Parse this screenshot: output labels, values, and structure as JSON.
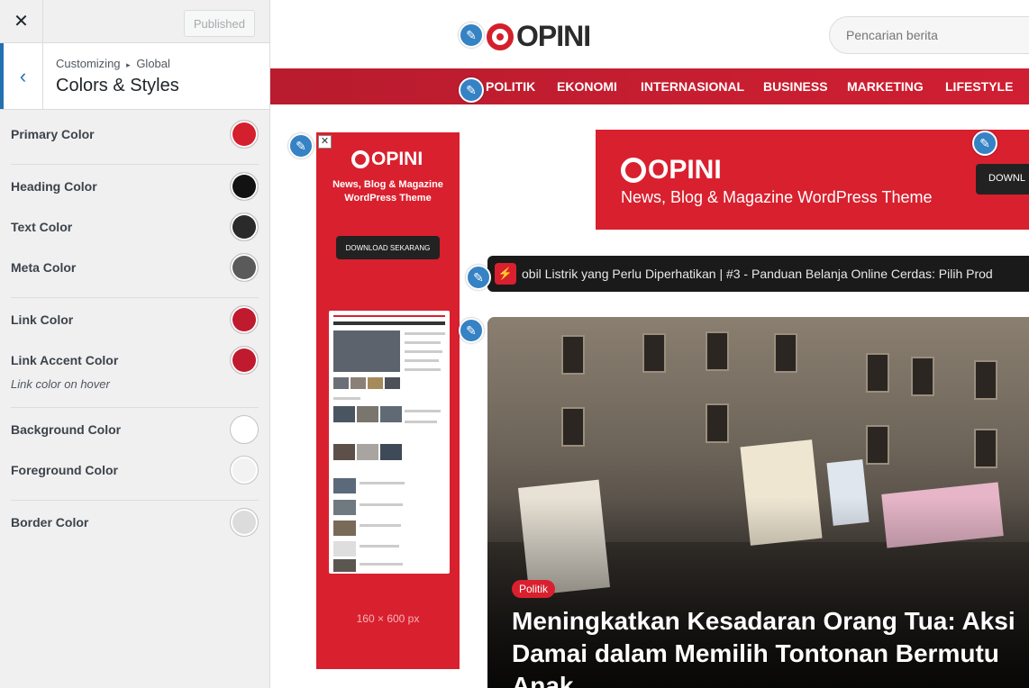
{
  "customizer": {
    "close_label": "✕",
    "publish_label": "Published",
    "back_label": "‹",
    "breadcrumb": {
      "root": "Customizing",
      "separator": "▸",
      "section": "Global"
    },
    "section_title": "Colors & Styles",
    "colors": [
      {
        "label": "Primary Color",
        "value": "#d4202c"
      },
      {
        "label": "Heading Color",
        "value": "#121212"
      },
      {
        "label": "Text Color",
        "value": "#2a2a2a"
      },
      {
        "label": "Meta Color",
        "value": "#5a5a5a"
      },
      {
        "label": "Link Color",
        "value": "#c01a2e"
      },
      {
        "label": "Link Accent Color",
        "value": "#c01a2e",
        "note": "Link color on hover"
      },
      {
        "label": "Background Color",
        "value": "#ffffff"
      },
      {
        "label": "Foreground Color",
        "value": "#f2f2f2"
      },
      {
        "label": "Border Color",
        "value": "#dcdcdc"
      }
    ]
  },
  "site": {
    "logo_text": "OPINI",
    "search_placeholder": "Pencarian berita",
    "nav": [
      "POLITIK",
      "EKONOMI",
      "INTERNASIONAL",
      "BUSINESS",
      "MARKETING",
      "LIFESTYLE"
    ],
    "brand_color": "#d9202e",
    "side_ad": {
      "close": "✕",
      "logo_text": "OPINI",
      "tagline": "News, Blog & Magazine WordPress Theme",
      "button": "DOWNLOAD SEKARANG",
      "size_label": "160 × 600 px"
    },
    "banner": {
      "logo_text": "OPINI",
      "tagline": "News, Blog & Magazine WordPress Theme",
      "button": "DOWNL"
    },
    "ticker": {
      "icon": "⚡",
      "text": "obil Listrik yang Perlu Diperhatikan  |  #3 - Panduan Belanja Online Cerdas: Pilih Prod"
    },
    "hero": {
      "category": "Politik",
      "title": "Meningkatkan Kesadaran Orang Tua: Aksi Damai dalam Memilih Tontonan Bermutu Anak"
    },
    "edit_icon": "✎"
  }
}
